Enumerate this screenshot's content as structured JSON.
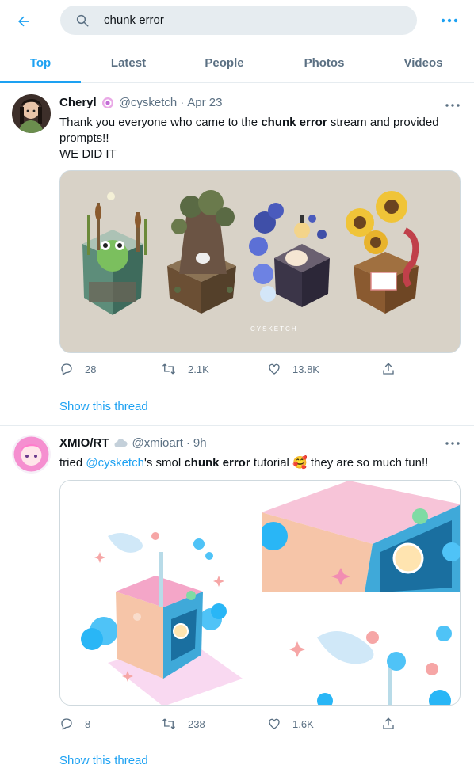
{
  "search": {
    "value": "chunk error"
  },
  "tabs": [
    "Top",
    "Latest",
    "People",
    "Photos",
    "Videos"
  ],
  "tweets": [
    {
      "name": "Cheryl",
      "handle": "@cysketch",
      "separator": "·",
      "date": "Apr 23",
      "text_before": "Thank you everyone who came to the ",
      "text_bold": "chunk error",
      "text_after": " stream and provided prompts!!",
      "text_line2": "WE DID IT",
      "image_watermark": "CYSKETCH",
      "replies": "28",
      "retweets": "2.1K",
      "likes": "13.8K",
      "thread_link": "Show this thread"
    },
    {
      "name": "XMIO/RT",
      "handle": "@xmioart",
      "separator": "·",
      "date": "9h",
      "text_before": "tried ",
      "mention": "@cysketch",
      "text_mid": "'s smol ",
      "text_bold": "chunk error",
      "text_after": " tutorial",
      "emoji": "🥰",
      "text_end": " they are so much fun!!",
      "replies": "8",
      "retweets": "238",
      "likes": "1.6K",
      "thread_link": "Show this thread"
    }
  ],
  "colors": {
    "accent": "#1da1f2",
    "secondary": "#5b7083",
    "text": "#0f1419"
  }
}
